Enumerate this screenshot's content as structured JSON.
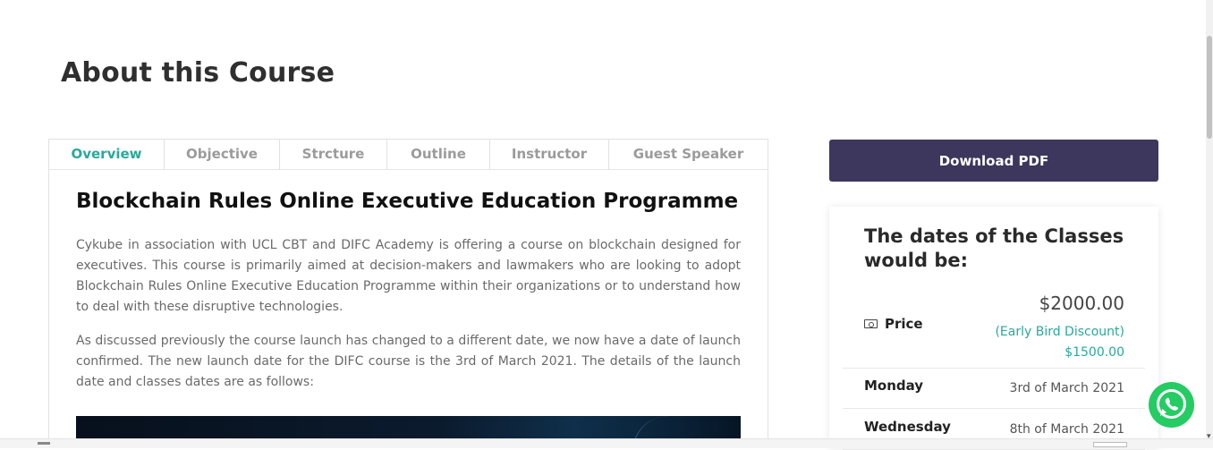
{
  "section": {
    "title": "About this Course"
  },
  "tabs": [
    {
      "label": "Overview"
    },
    {
      "label": "Objective"
    },
    {
      "label": "Strcture"
    },
    {
      "label": "Outline"
    },
    {
      "label": "Instructor"
    },
    {
      "label": "Guest Speaker"
    }
  ],
  "active_tab": "Overview",
  "overview": {
    "title": "Blockchain Rules Online Executive Education Programme",
    "paragraph_1": "Cykube in association with UCL CBT and DIFC Academy is offering a course on blockchain designed for executives. This course is primarily aimed at decision-makers and lawmakers who are looking to adopt Blockchain Rules Online Executive Education Programme within their organizations or to understand how to deal with these disruptive technologies.",
    "paragraph_2": "As discussed previously the course launch has changed to a different date, we now have a date of launch confirmed. The new launch date for the DIFC course is the 3rd of March 2021. The details of the launch date and classes dates are as follows:"
  },
  "download": {
    "label": "Download PDF"
  },
  "dates_card": {
    "title": "The dates of the Classes would be:",
    "price_label": "Price",
    "price_icon": "money-icon",
    "price_value": "$2000.00",
    "discount": "(Early Bird Discount) $1500.00",
    "rows": [
      {
        "day": "Monday",
        "date": "3rd of March 2021"
      },
      {
        "day": "Wednesday",
        "date": "8th of March 2021"
      }
    ]
  },
  "colors": {
    "accent_teal": "#2aa89a",
    "button_purple": "#3d375e",
    "whatsapp_green": "#24cc63"
  },
  "whatsapp": {
    "icon": "whatsapp-icon"
  }
}
